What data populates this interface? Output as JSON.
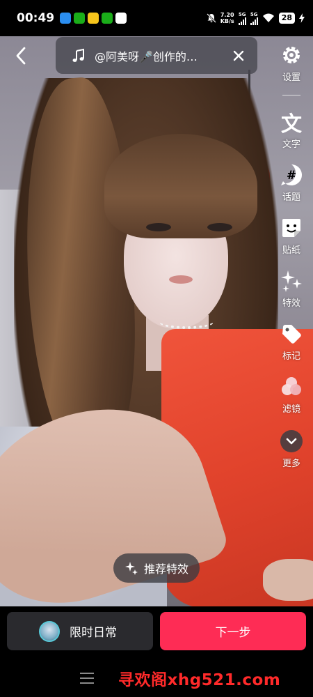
{
  "status_bar": {
    "time": "00:49",
    "net_speed_value": "7.20",
    "net_speed_unit": "KB/s",
    "signal1": "5G",
    "signal2": "5G",
    "battery": "28",
    "app_icon_colors": [
      "#2b8ef0",
      "#1aad19",
      "#f7c51c",
      "#1aad19",
      "#ffffff"
    ]
  },
  "top_bar": {
    "music_text": "@阿美呀🎤创作的…"
  },
  "toolbar": {
    "items": [
      {
        "label": "设置",
        "icon": "gear-icon"
      },
      {
        "label": "文字",
        "icon": "text-icon"
      },
      {
        "label": "话题",
        "icon": "hashtag-icon"
      },
      {
        "label": "贴纸",
        "icon": "sticker-icon"
      },
      {
        "label": "特效",
        "icon": "sparkle-icon"
      },
      {
        "label": "标记",
        "icon": "tag-icon"
      },
      {
        "label": "滤镜",
        "icon": "filter-icon"
      },
      {
        "label": "更多",
        "icon": "chevron-down-icon"
      }
    ]
  },
  "recommend": {
    "label": "推荐特效"
  },
  "bottom": {
    "daily_label": "限时日常",
    "next_label": "下一步",
    "watermark": "寻欢阁xhg521.com"
  },
  "colors": {
    "accent": "#fe2c55",
    "dress": "#e1432c"
  }
}
